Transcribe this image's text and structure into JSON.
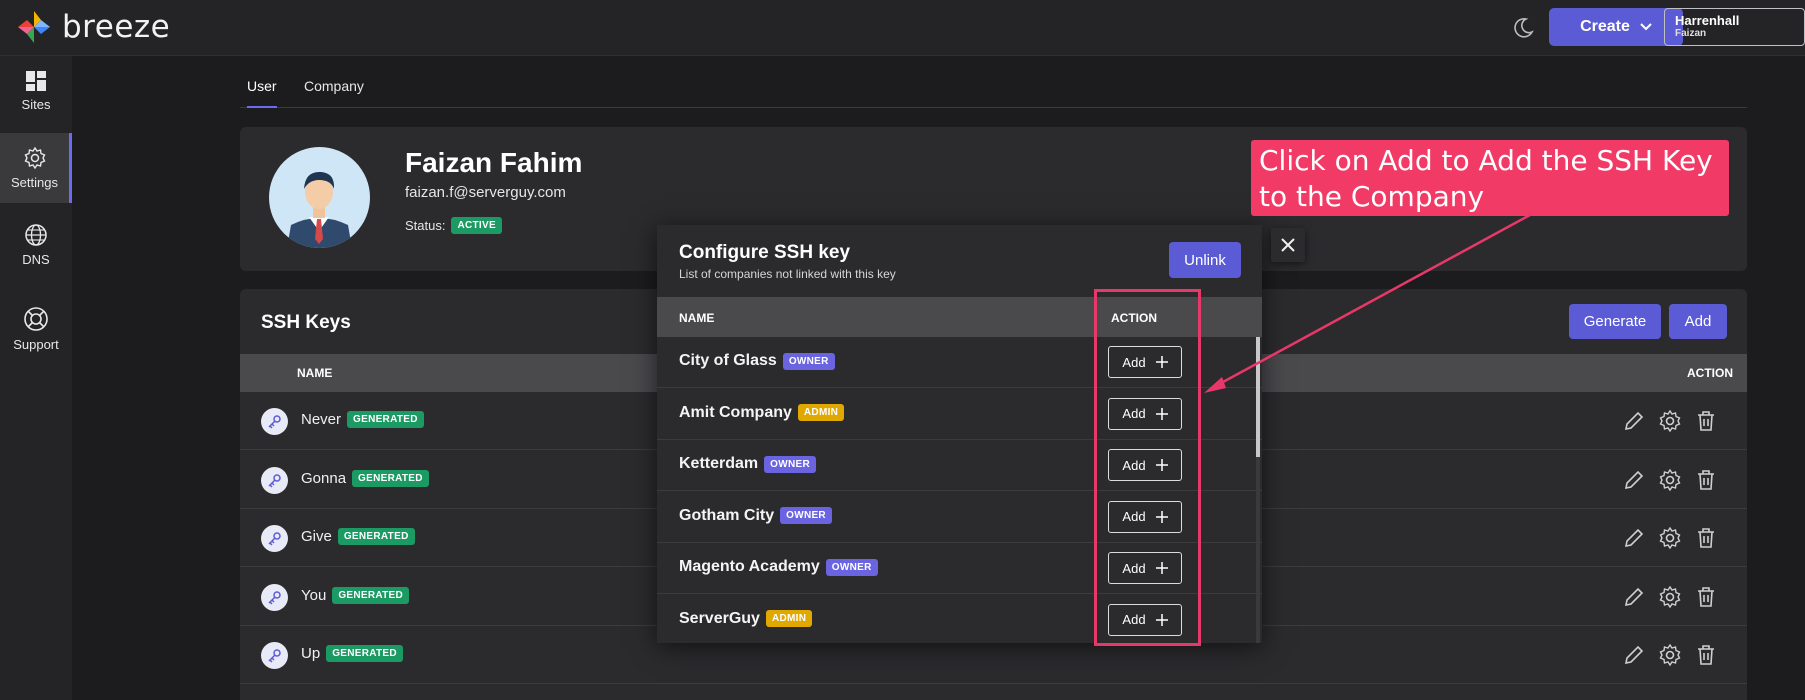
{
  "header": {
    "brand": "breeze",
    "create_label": "Create",
    "org_name": "Harrenhall",
    "org_user": "Faizan",
    "icons": [
      "logo-icon",
      "moon-icon",
      "chevron-down-icon"
    ]
  },
  "sidebar": {
    "items": [
      {
        "label": "Sites",
        "icon": "grid-icon"
      },
      {
        "label": "Settings",
        "icon": "gear-icon",
        "active": true
      },
      {
        "label": "DNS",
        "icon": "globe-icon"
      },
      {
        "label": "Support",
        "icon": "lifebuoy-icon"
      }
    ]
  },
  "tabs": [
    "User",
    "Company"
  ],
  "profile": {
    "name": "Faizan Fahim",
    "email": "faizan.f@serverguy.com",
    "status_label": "Status:",
    "status_value": "ACTIVE"
  },
  "ssh_keys": {
    "title": "SSH Keys",
    "generate_label": "Generate",
    "add_label": "Add",
    "col_name": "NAME",
    "col_action": "ACTION",
    "rows": [
      {
        "name": "Never",
        "badge": "GENERATED"
      },
      {
        "name": "Gonna",
        "badge": "GENERATED"
      },
      {
        "name": "Give",
        "badge": "GENERATED"
      },
      {
        "name": "You",
        "badge": "GENERATED"
      },
      {
        "name": "Up",
        "badge": "GENERATED"
      }
    ]
  },
  "modal": {
    "title": "Configure SSH key",
    "subtitle": "List of companies not linked with this key",
    "unlink_label": "Unlink",
    "col_name": "NAME",
    "col_action": "ACTION",
    "add_label": "Add",
    "rows": [
      {
        "company": "City of Glass",
        "role": "OWNER"
      },
      {
        "company": "Amit Company",
        "role": "ADMIN"
      },
      {
        "company": "Ketterdam",
        "role": "OWNER"
      },
      {
        "company": "Gotham City",
        "role": "OWNER"
      },
      {
        "company": "Magento Academy",
        "role": "OWNER"
      },
      {
        "company": "ServerGuy",
        "role": "ADMIN"
      }
    ]
  },
  "annotation": {
    "text": "Click on Add to Add the SSH Key to the Company",
    "color": "#f23a66"
  },
  "colors": {
    "accent": "#5b5bd6",
    "generated": "#1c9a64",
    "owner": "#6a64e0",
    "admin": "#e0a800"
  }
}
